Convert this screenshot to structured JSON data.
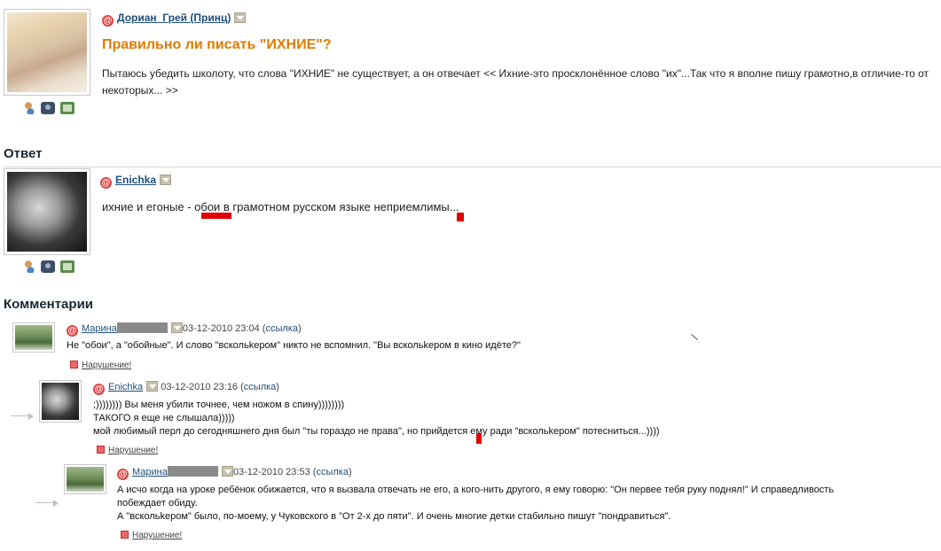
{
  "question": {
    "author": "Дориан_Грей (Принц)",
    "title": "Правильно ли писать \"ИХНИЕ\"?",
    "text": "Пытаюсь убедить школоту, что слова \"ИХНИЕ\" не существует, а он отвечает << Ихние-это просклонённое слово \"их\"...Так что я вполне пишу грамотно,в отличие-то от некоторых... >>"
  },
  "answer_section": {
    "title": "Ответ",
    "author": "Enichka",
    "text": "ихние и егоные - обои в грамотном русском языке неприемлимы..."
  },
  "comments_section": {
    "title": "Комментарии",
    "comments": [
      {
        "author": "Марина",
        "date": "03-12-2010 23:04",
        "link_label": "ссылка",
        "text": "Не \"обои\", а \"обойные\". И слово \"вскольkером\" никто не вспомнил. \"Вы вскольkером в кино идёте?\"",
        "violation": "Нарушение!"
      },
      {
        "author": "Enichka",
        "date": "03-12-2010 23:16",
        "link_label": "ссылка",
        "line1": ";)))))))) Вы меня убили точнее, чем ножом в спину))))))))",
        "line2": "ТАКОГО я еще не слышала)))))",
        "line3": "мой любимый перл до сегодняшнего дня был \"ты гораздо не права\", но прийдется ему ради \"вскольkером\" потесниться...))))",
        "violation": "Нарушение!"
      },
      {
        "author": "Марина",
        "date": "03-12-2010 23:53",
        "link_label": "ссылка",
        "line1": "А исчо когда на уроке ребёнок обижается, что я вызвала отвечать не его, а кого-нить другого, я ему говорю: \"Он первее тебя руку поднял!\" И справедливость",
        "line2": "побеждает обиду.",
        "line3": "А \"вскольkером\" было, по-моему, у Чуковского в \"От 2-х до пяти\". И очень многие детки стабильно пишут \"пондравиться\".",
        "violation": "Нарушение!"
      }
    ]
  }
}
